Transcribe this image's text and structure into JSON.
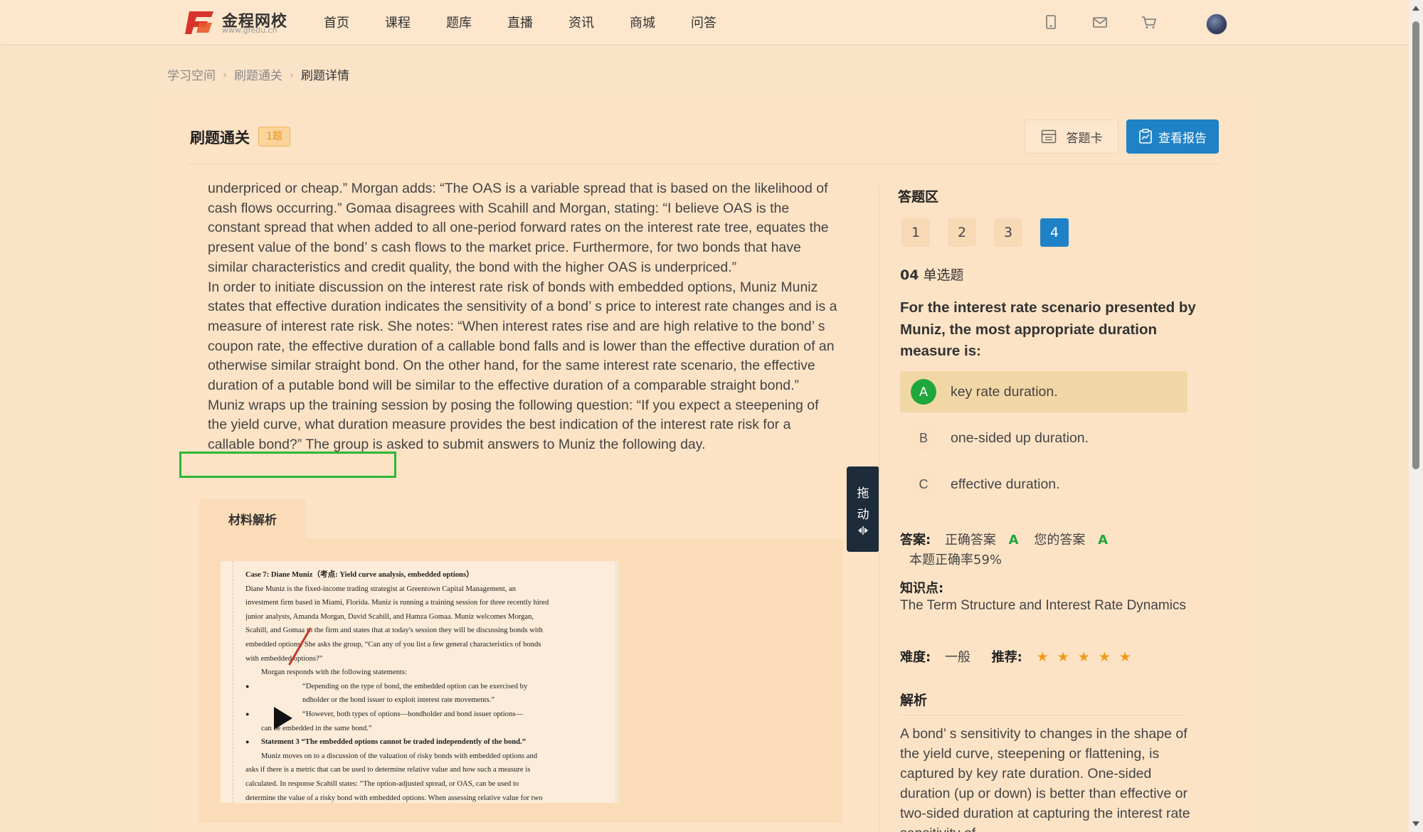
{
  "header": {
    "logo_name": "金程网校",
    "logo_url": "www.gfedu.cn",
    "nav": [
      "首页",
      "课程",
      "题库",
      "直播",
      "资讯",
      "商城",
      "问答"
    ]
  },
  "breadcrumb": [
    "学习空间",
    "刷题通关",
    "刷题详情"
  ],
  "card": {
    "title": "刷题通关",
    "badge": "1题",
    "answer_card_label": "答题卡",
    "report_label": "查看报告"
  },
  "passage": [
    "underpriced or cheap.”   Morgan adds:  “The OAS is a variable spread that is based on the likelihood of cash flows occurring.”   Gomaa disagrees with Scahill and Morgan, stating:  “I believe OAS is the constant spread that when added to all one-period forward rates on the interest rate tree, equates the present value of the bond’ s cash flows to the market price. Furthermore, for two bonds that have similar characteristics and credit quality, the bond with the higher OAS is underpriced.”",
    "In order to initiate discussion on the interest rate risk of bonds with embedded options, Muniz Muniz states that effective duration indicates the sensitivity of a bond’ s price to interest rate changes and is a measure of interest rate risk. She notes:  “When interest rates rise and are high relative to the bond’ s coupon rate, the effective duration of a callable bond falls and is lower than the effective duration of an otherwise similar straight bond. On the other hand, for the same interest rate scenario, the effective duration of a putable bond will be similar to the effective duration of a comparable straight bond.”",
    "Muniz wraps up the training session by posing the following question:  “If you expect a steepening of the yield curve, what duration measure provides the best indication of the interest rate risk for a callable bond?”   The group is asked to submit answers to Muniz the following day."
  ],
  "material": {
    "tab_label": "材料解析",
    "doc_lines": [
      "Case 7: Diane Muniz（考点: Yield curve analysis, embedded options）",
      "Diane Muniz is the fixed-income trading strategist at Greentown Capital Management, an",
      "investment firm based in Miami, Florida. Muniz is running a training session for three recently hired",
      "junior analysts, Amanda Morgan, David Scahill, and Hamza Gomaa. Muniz welcomes Morgan,",
      "Scahill, and Gomaa to the firm and states that at today's session they will be discussing bonds with",
      "embedded options. She asks the group, “Can any of you list a few general characteristics of bonds",
      "with embedded options?”",
      "Morgan responds with the following statements:",
      "“Depending on the type of bond, the embedded option can be exercised by",
      "ndholder or the bond issuer to exploit interest rate movements.”",
      "“However, both types of options—bondholder and bond issuer options—",
      "can be embedded in the same bond.”",
      "Statement 3   “The embedded options cannot be traded independently of the bond.”",
      "Muniz moves on to a discussion of the valuation of risky bonds with embedded options and",
      "asks if there is a metric that can be used to determine relative value and how such a measure is",
      "calculated. In response Scahill states: “The option-adjusted spread, or OAS, can be used to",
      "determine the value of a risky bond with embedded options. When assessing relative value for two"
    ]
  },
  "drag_handle": [
    "拖",
    "动"
  ],
  "answer_area": {
    "title": "答题区",
    "question_numbers": [
      "1",
      "2",
      "3",
      "4"
    ],
    "active_question": "4",
    "question_index": "04",
    "question_type": "单选题",
    "question_text": "For the interest rate scenario presented by Muniz, the most appropriate duration measure is:",
    "options": [
      {
        "letter": "A",
        "text": "key rate duration."
      },
      {
        "letter": "B",
        "text": "one-sided up duration."
      },
      {
        "letter": "C",
        "text": "effective duration."
      }
    ],
    "selected_option": "A",
    "answer_label": "答案:",
    "correct_label": "正确答案",
    "correct_answer": "A",
    "your_label": "您的答案",
    "your_answer": "A",
    "accuracy": "本题正确率59%",
    "knowledge_label": "知识点:",
    "knowledge_text": "The Term Structure and Interest Rate Dynamics",
    "difficulty_label": "难度:",
    "difficulty_value": "一般",
    "recommend_label": "推荐:",
    "recommend_stars": 5,
    "analysis_label": "解析",
    "analysis_text": "A bond’ s sensitivity to changes in the shape of the yield curve, steepening or flattening, is captured by key rate duration. One-sided duration (up or down) is better than effective or two-sided duration at capturing the interest rate sensitivity of"
  },
  "colors": {
    "accent_blue": "#1f82c6",
    "correct_green": "#1ea83b",
    "highlight_green": "#2db634",
    "star_orange": "#ef9b1a"
  }
}
